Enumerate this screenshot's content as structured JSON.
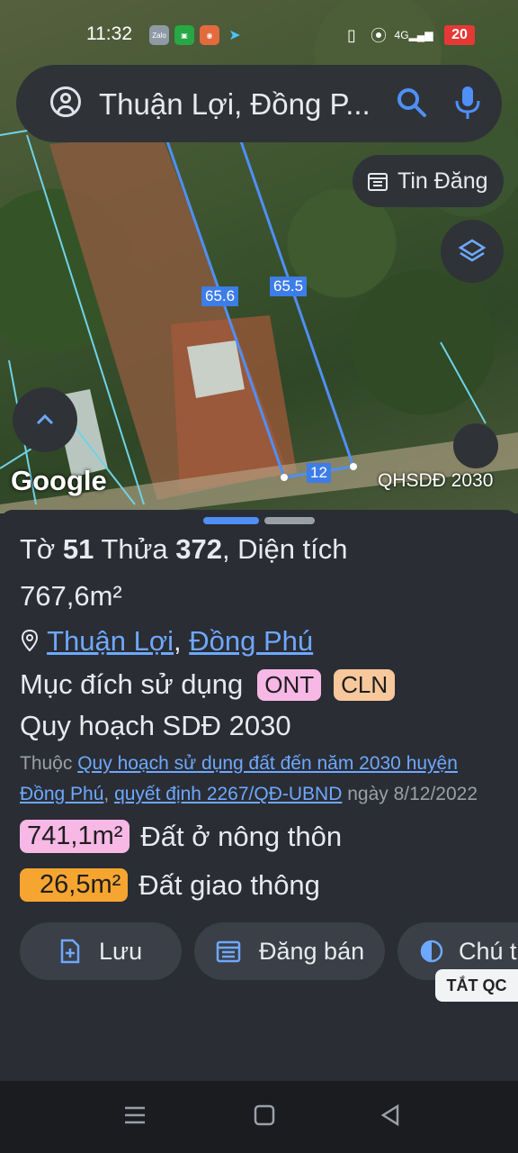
{
  "status": {
    "time": "11:32",
    "battery": "20",
    "network": "4G"
  },
  "search": {
    "value": "Thuận Lợi, Đồng P..."
  },
  "map": {
    "tin_dang_label": "Tin Đăng",
    "labels": {
      "edge_a": "65.6",
      "edge_b": "65.5",
      "front": "12"
    },
    "google": "Google",
    "layer_name": "QHSDĐ 2030"
  },
  "parcel": {
    "to_prefix": "Tờ ",
    "to": "51",
    "thua_prefix": " Thửa ",
    "thua": "372",
    "dien_tich_label": ", Diện tích",
    "area": "767,6m²",
    "commune": "Thuận Lợi",
    "district": "Đồng Phú",
    "purpose_label": "Mục đích sử dụng",
    "purpose_tags": [
      {
        "code": "ONT",
        "color": "#f7b8e6"
      },
      {
        "code": "CLN",
        "color": "#f7c89b"
      }
    ],
    "plan_title": "Quy hoạch SDĐ 2030",
    "source_prefix": "Thuộc",
    "source_plan": "Quy hoạch sử dụng đất đến năm 2030 huyện",
    "source_district": "Đồng Phú",
    "decision": "quyết định 2267/QĐ-UBND",
    "date": "ngày 8/12/2022",
    "areas": [
      {
        "value": "741,1m²",
        "label": "Đất ở nông thôn",
        "color": "#f7b8e6"
      },
      {
        "value": "26,5m²",
        "label": "Đất giao thông",
        "color": "#f7a531"
      }
    ]
  },
  "actions": {
    "save": "Lưu",
    "post": "Đăng bán",
    "note": "Chú t"
  },
  "ad_close": "TẮT QC",
  "colors": {
    "accent": "#6ea8fe",
    "parcel_line": "#4f8ff7"
  }
}
